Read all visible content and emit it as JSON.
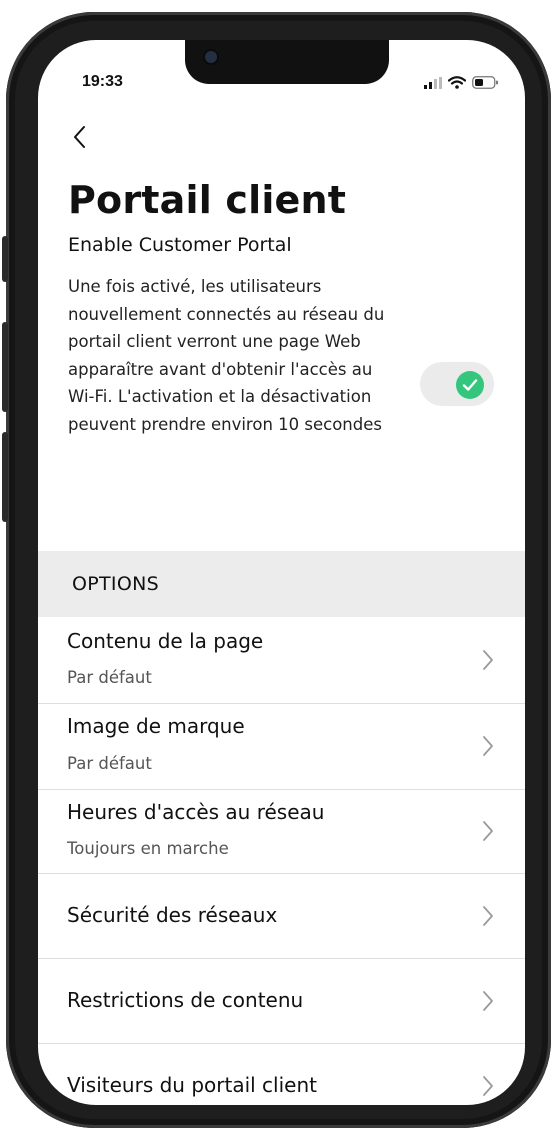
{
  "status_bar": {
    "time": "19:33",
    "signal_icon": "cellular-signal-icon",
    "wifi_icon": "wifi-icon",
    "battery_icon": "battery-icon"
  },
  "nav": {
    "back_icon": "chevron-left-icon"
  },
  "page": {
    "title": "Portail client"
  },
  "portal_toggle": {
    "label": "Enable Customer Portal",
    "description": "Une fois activé, les utilisateurs nouvellement connectés au réseau du portail client verront une page Web apparaître avant d'obtenir l'accès au Wi-Fi. L'activation et la désactivation peuvent prendre environ 10 secondes",
    "enabled": true,
    "on_color": "#34c67d",
    "check_icon": "check-icon"
  },
  "options": {
    "header": "OPTIONS",
    "items": [
      {
        "title": "Contenu de la page",
        "subtitle": "Par défaut"
      },
      {
        "title": "Image de marque",
        "subtitle": "Par défaut"
      },
      {
        "title": "Heures d'accès au réseau",
        "subtitle": "Toujours en marche"
      },
      {
        "title": "Sécurité des réseaux",
        "subtitle": ""
      },
      {
        "title": "Restrictions de contenu",
        "subtitle": ""
      },
      {
        "title": "Visiteurs du portail client",
        "subtitle": ""
      }
    ],
    "chevron_icon": "chevron-right-icon"
  }
}
